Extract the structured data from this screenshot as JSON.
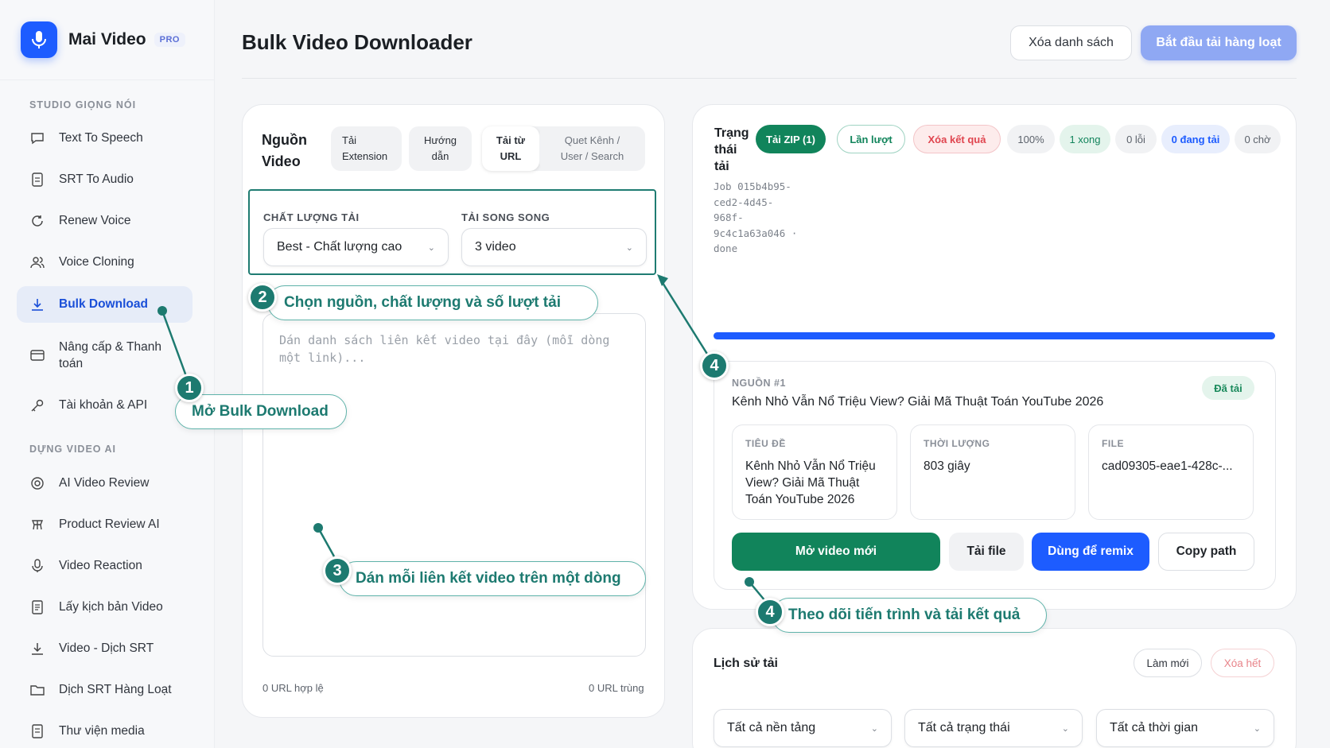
{
  "brand": {
    "name": "Mai Video",
    "badge": "PRO"
  },
  "sidebar": {
    "sections": [
      "STUDIO GIỌNG NÓI",
      "DỰNG VIDEO AI"
    ],
    "items": [
      {
        "label": "Text To Speech",
        "icon": "chat-bubble-icon"
      },
      {
        "label": "SRT To Audio",
        "icon": "document-icon"
      },
      {
        "label": "Renew Voice",
        "icon": "refresh-icon"
      },
      {
        "label": "Voice Cloning",
        "icon": "users-icon"
      },
      {
        "label": "Bulk Download",
        "icon": "download-icon",
        "active": true
      },
      {
        "label": "Nâng cấp & Thanh toán",
        "icon": "credit-card-icon"
      },
      {
        "label": "Tài khoản & API",
        "icon": "key-icon"
      },
      {
        "label": "AI Video Review",
        "icon": "target-icon"
      },
      {
        "label": "Product Review AI",
        "icon": "product-icon"
      },
      {
        "label": "Video Reaction",
        "icon": "microphone-icon"
      },
      {
        "label": "Lấy kịch bản Video",
        "icon": "script-icon"
      },
      {
        "label": "Video - Dịch SRT",
        "icon": "download-icon"
      },
      {
        "label": "Dịch SRT Hàng Loạt",
        "icon": "folder-icon"
      },
      {
        "label": "Thư viện media",
        "icon": "library-icon"
      }
    ]
  },
  "header": {
    "title": "Bulk Video Downloader",
    "clear_label": "Xóa danh sách",
    "start_label": "Bắt đầu tải hàng loạt"
  },
  "source": {
    "title_line1": "Nguồn",
    "title_line2": "Video",
    "tabs": [
      {
        "l1": "Tải",
        "l2": "Extension"
      },
      {
        "l1": "Hướng",
        "l2": "dẫn"
      },
      {
        "l1": "Tải từ",
        "l2": "URL"
      },
      {
        "l1": "Quet Kênh /",
        "l2": "User / Search"
      }
    ],
    "quality_label": "CHẤT LƯỢNG TẢI",
    "quality_value": "Best - Chất lượng cao",
    "parallel_label": "TẢI SONG SONG",
    "parallel_value": "3 video",
    "placeholder": "Dán danh sách liên kết video tại đây (mỗi dòng một link)...",
    "valid_count": "0 URL hợp lệ",
    "dup_count": "0 URL trùng"
  },
  "status": {
    "title": "Trạng thái tải",
    "job_text": "Job 015b4b95-ced2-4d45-968f-9c4c1a63a046 · done",
    "chips": {
      "zip": "Tải ZIP (1)",
      "sequential": "Lần lượt",
      "clear_results": "Xóa kết quả",
      "percent": "100%",
      "done": "1 xong",
      "errors": "0 lỗi",
      "downloading": "0 đang tải",
      "waiting": "0 chờ"
    },
    "progress": 1.0
  },
  "result": {
    "source_num": "NGUỒN #1",
    "source_name": "Kênh Nhỏ Vẫn Nổ Triệu View? Giải Mã Thuật Toán YouTube 2026",
    "badge": "Đã tải",
    "title_label": "TIÊU ĐỀ",
    "title_value": "Kênh Nhỏ Vẫn Nổ Triệu View? Giải Mã Thuật Toán YouTube 2026",
    "duration_label": "THỜI LƯỢNG",
    "duration_value": "803 giây",
    "file_label": "FILE",
    "file_value": "cad09305-eae1-428c-...",
    "actions": {
      "open_new": "Mở video mới",
      "download_file": "Tải file",
      "remix": "Dùng để remix",
      "copy_path": "Copy path"
    }
  },
  "history": {
    "title": "Lịch sử tải",
    "refresh_label": "Làm mới",
    "delete_all_label": "Xóa hết",
    "filters": [
      "Tất cả nền tảng",
      "Tất cả trạng thái",
      "Tất cả thời gian"
    ]
  },
  "callouts": [
    {
      "num": "1",
      "text": "Mở Bulk Download"
    },
    {
      "num": "2",
      "text": "Chọn nguồn, chất lượng và số lượt tải"
    },
    {
      "num": "3",
      "text": "Dán mỗi liên kết video trên một dòng"
    },
    {
      "num": "4",
      "text": "Theo dõi tiến trình và tải kết quả"
    },
    {
      "num": "4"
    }
  ],
  "colors": {
    "brand_blue": "#1d5cff",
    "teal": "#1d7a70",
    "success_green": "#11845b",
    "danger_red": "#e0454f"
  }
}
